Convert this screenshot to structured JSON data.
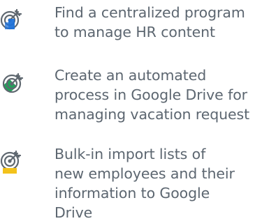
{
  "goals": [
    {
      "icon": "target-icon",
      "accent_color": "#1e72d9",
      "lines": [
        "Find a centralized program",
        "to manage HR content"
      ]
    },
    {
      "icon": "target-icon",
      "accent_color": "#23a05a",
      "lines": [
        "Create an automated",
        "process in Google Drive for",
        "managing vacation request"
      ]
    },
    {
      "icon": "target-icon",
      "accent_color": "#f3c21b",
      "lines": [
        "Bulk-in import lists of",
        "new employees and their",
        "information to Google",
        "Drive"
      ]
    }
  ]
}
